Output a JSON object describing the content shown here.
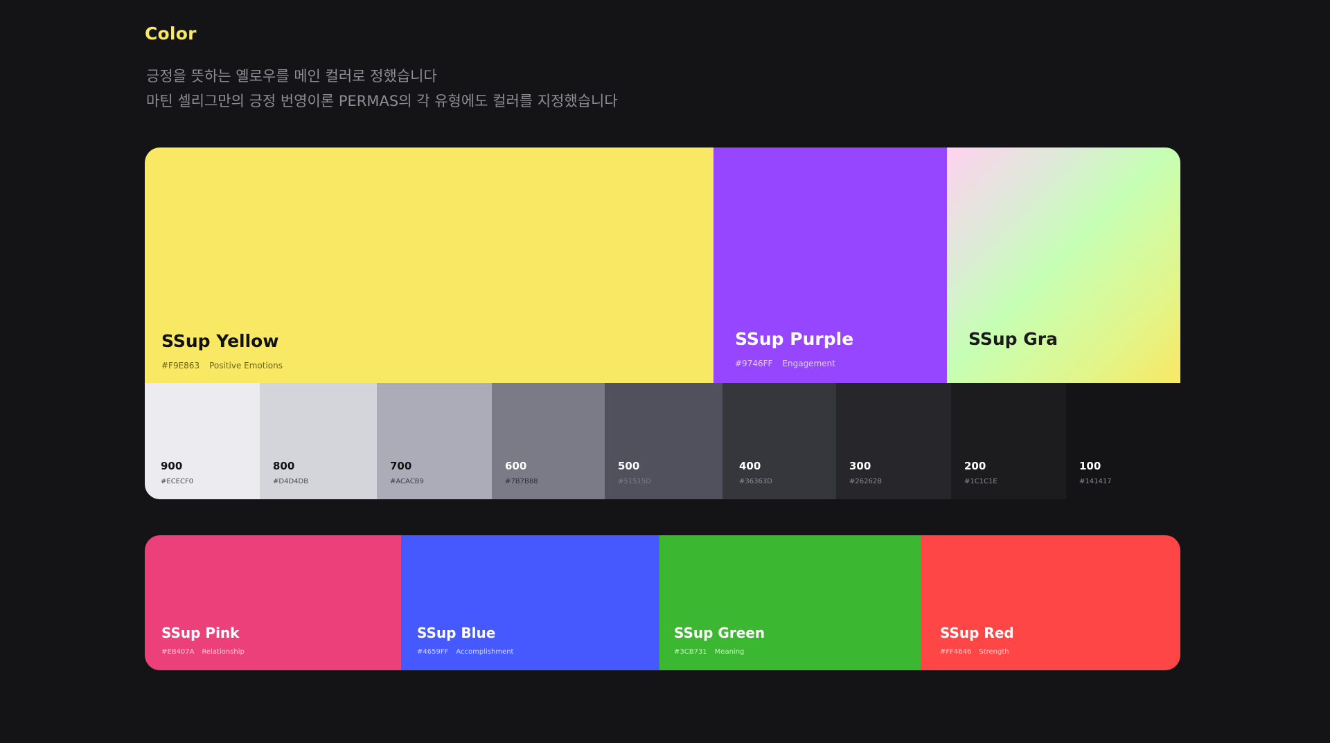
{
  "header": {
    "title": "Color",
    "description": [
      "긍정을 뜻하는 옐로우를 메인 컬러로 정했습니다",
      "마틴 셀리그만의 긍정 번영이론 PERMAS의 각 유형에도 컬러를 지정했습니다"
    ]
  },
  "primary": [
    {
      "name": "SSup Yellow",
      "hex": "#F9E863",
      "meaning": "Positive Emotions",
      "color": "#F9E863",
      "text_color": "#111111",
      "meta_color": "#6b6418"
    },
    {
      "name": "SSup Purple",
      "hex": "#9746FF",
      "meaning": "Engagement",
      "color": "#9746FF",
      "text_color": "#ffffff",
      "meta_color": "#e2cdff"
    },
    {
      "name": "SSup Gra",
      "text_color": "#1b1b1b"
    }
  ],
  "grays": [
    {
      "label": "900",
      "hex": "#ECECF0",
      "color": "#ECECF0",
      "text_color": "#111111",
      "hex_color": "#4a4a50"
    },
    {
      "label": "800",
      "hex": "#D4D4DB",
      "color": "#D4D4DB",
      "text_color": "#111111",
      "hex_color": "#4a4a50"
    },
    {
      "label": "700",
      "hex": "#ACACB9",
      "color": "#ACACB9",
      "text_color": "#111111",
      "hex_color": "#3d3d44"
    },
    {
      "label": "600",
      "hex": "#7B7B88",
      "color": "#7B7B88",
      "text_color": "#ffffff",
      "hex_color": "#2f2f36"
    },
    {
      "label": "500",
      "hex": "#51515D",
      "color": "#51515D",
      "text_color": "#ffffff",
      "hex_color": "#7d7d88"
    },
    {
      "label": "400",
      "hex": "#36363D",
      "color": "#36363D",
      "text_color": "#ffffff",
      "hex_color": "#8a8a95"
    },
    {
      "label": "300",
      "hex": "#26262B",
      "color": "#26262B",
      "text_color": "#ffffff",
      "hex_color": "#8a8a95"
    },
    {
      "label": "200",
      "hex": "#1C1C1E",
      "color": "#1C1C1E",
      "text_color": "#ffffff",
      "hex_color": "#8a8a95"
    },
    {
      "label": "100",
      "hex": "#141417",
      "color": "#141417",
      "text_color": "#ffffff",
      "hex_color": "#8a8a95"
    }
  ],
  "accents": [
    {
      "name": "SSup Pink",
      "hex": "#EB407A",
      "meaning": "Relationship",
      "color": "#EB407A"
    },
    {
      "name": "SSup Blue",
      "hex": "#4659FF",
      "meaning": "Accomplishment",
      "color": "#4659FF"
    },
    {
      "name": "SSup Green",
      "hex": "#3CB731",
      "meaning": "Meaning",
      "color": "#3CB731"
    },
    {
      "name": "SSup Red",
      "hex": "#FF4646",
      "meaning": "Strength",
      "color": "#FF4646"
    }
  ]
}
